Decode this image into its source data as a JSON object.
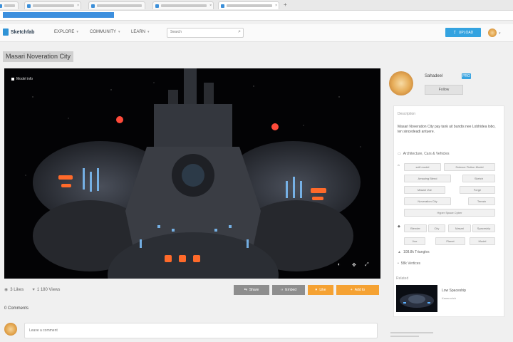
{
  "browser": {
    "tabs": [
      {
        "label": ""
      },
      {
        "label": ""
      },
      {
        "label": ""
      },
      {
        "label": ""
      },
      {
        "label": ""
      }
    ],
    "tab_close_glyph": "×",
    "new_tab_glyph": "+"
  },
  "header": {
    "logo_text": "Sketchfab",
    "nav": [
      {
        "label": "EXPLORE"
      },
      {
        "label": "COMMUNITY"
      },
      {
        "label": "LEARN"
      }
    ],
    "search_placeholder": "Search",
    "upload_label": "UPLOAD"
  },
  "model": {
    "title": "Masari Noveration City",
    "viewer_badge": "Model info",
    "stats": [
      {
        "icon": "eye-icon",
        "value": "3 Likes"
      },
      {
        "icon": "heart-icon",
        "value": "1 180 Views"
      }
    ],
    "actions": [
      {
        "label": "Share",
        "style": "grey",
        "icon": "share-icon"
      },
      {
        "label": "Embed",
        "style": "grey",
        "icon": "embed-icon"
      },
      {
        "label": "Like",
        "style": "orange",
        "icon": "heart-icon"
      },
      {
        "label": "Add to",
        "style": "orange",
        "icon": "plus-icon"
      }
    ],
    "comments_heading": "0 Comments",
    "comment_placeholder": "Leave a comment"
  },
  "author": {
    "name": "Sahadeel",
    "badge": "PRO",
    "follow_label": "Follow"
  },
  "sidebar": {
    "heading": "Description",
    "description": "Masari Noveration City pay tank uit bundis nee Lobhidea lobo, ten sincedeadi antuere.",
    "categories_label": "Architecture, Cars & Vehicles",
    "tags": [
      [
        "scifi model",
        "Science Fiction Model"
      ],
      [
        "Amazing Blend",
        "Sketch"
      ],
      [
        "Masari Voe",
        "Forge"
      ],
      [
        "Noveration City",
        "Terrain"
      ],
      [
        "Hyper Space Cyber"
      ]
    ],
    "tags2": [
      [
        "Blender",
        "City",
        "Masari",
        "Spaceship"
      ],
      [
        "Voe",
        "Planet",
        "Model"
      ]
    ],
    "triangles": "108.8k Triangles",
    "vertices": "58k Vertices",
    "related_heading": "Related",
    "related_title": "Low Spaceship",
    "related_author": "Kanerovich"
  },
  "colors": {
    "accent": "#34a3e0",
    "orange": "#f5a233",
    "grey_button": "#8e8e8e"
  }
}
